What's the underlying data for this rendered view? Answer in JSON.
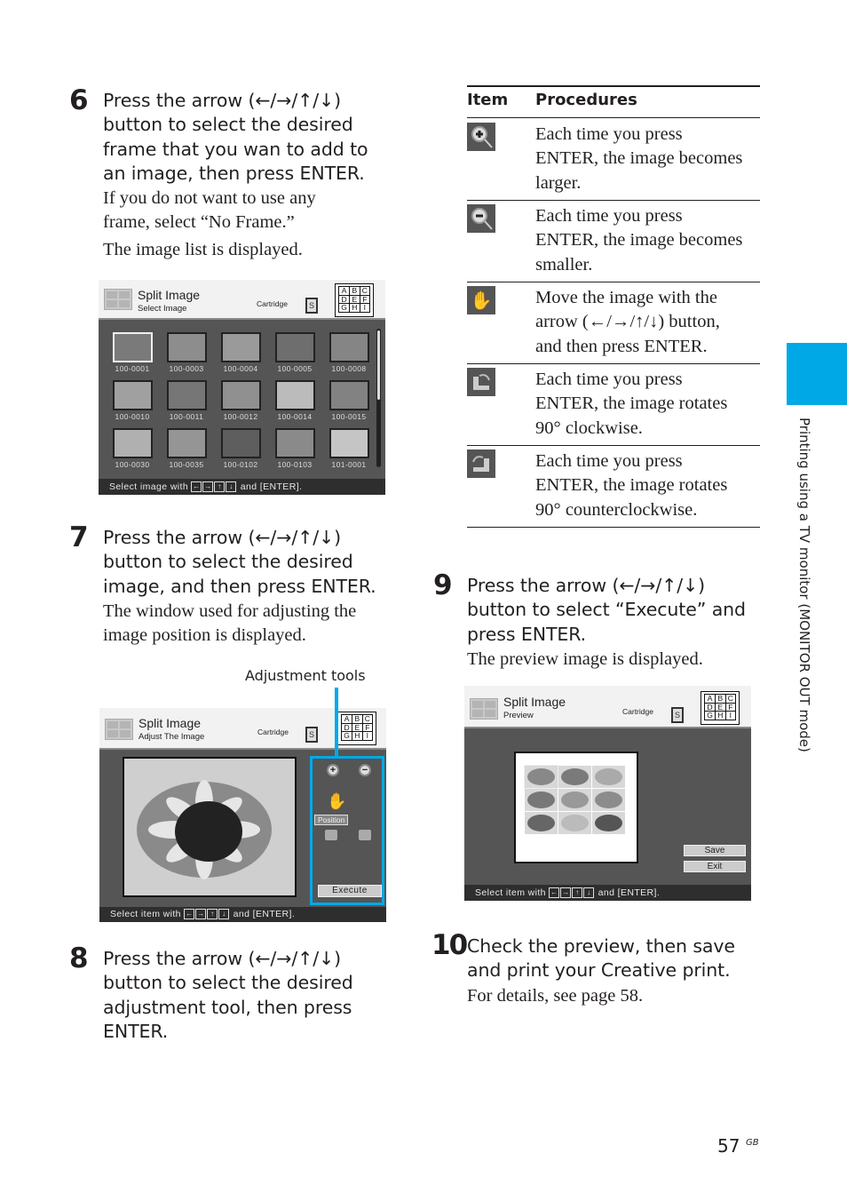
{
  "page": {
    "number": "57",
    "region_suffix": "GB",
    "side_tab_text": "Printing using a TV monitor  (MONITOR OUT mode)",
    "accent_color": "#00a9e6"
  },
  "arrows": "(←/→/↑/↓)",
  "steps": {
    "s6": {
      "number": "6",
      "heading_lines": [
        "Press the arrow  (←/→/↑/↓)",
        "button to select the desired",
        "frame that you wan to add to",
        "an image, then press ENTER."
      ],
      "body_lines": [
        "If you do not want to use any",
        "frame, select “No Frame.”"
      ],
      "result": "The image list is displayed."
    },
    "s7": {
      "number": "7",
      "heading_lines": [
        "Press the arrow (←/→/↑/↓)",
        "button to select the desired",
        "image, and then press ENTER."
      ],
      "body_lines": [
        "The window used for adjusting the",
        "image position is displayed."
      ],
      "callout": "Adjustment tools"
    },
    "s8": {
      "number": "8",
      "heading_lines": [
        "Press the arrow (←/→/↑/↓)",
        "button to select the desired",
        "adjustment tool, then press",
        "ENTER."
      ]
    },
    "s9": {
      "number": "9",
      "heading_lines": [
        "Press the arrow  (←/→/↑/↓)",
        "button to select “Execute” and",
        "press ENTER."
      ],
      "result": "The preview image is displayed."
    },
    "s10": {
      "number": "10",
      "heading_lines": [
        "Check the preview, then save",
        "and print your Creative print."
      ],
      "body": "For details, see page 58."
    }
  },
  "screens": {
    "common": {
      "title": "Split Image",
      "cartridge_label": "Cartridge",
      "cartridge_letter": "S",
      "grid_letters": [
        [
          "A",
          "B",
          "C"
        ],
        [
          "D",
          "E",
          "F"
        ],
        [
          "G",
          "H",
          "I"
        ]
      ],
      "keys": [
        "←",
        "→",
        "↑",
        "↓"
      ],
      "enter": "and [ENTER]."
    },
    "select": {
      "subtitle": "Select Image",
      "footer_prefix": "Select image with",
      "thumbnails": [
        "100-0001",
        "100-0003",
        "100-0004",
        "100-0005",
        "100-0008",
        "100-0010",
        "100-0011",
        "100-0012",
        "100-0014",
        "100-0015",
        "100-0030",
        "100-0035",
        "100-0102",
        "100-0103",
        "101-0001"
      ],
      "selected_index": 0
    },
    "adjust": {
      "subtitle": "Adjust The Image",
      "footer_prefix": "Select item with",
      "tools": [
        "zoom-in",
        "zoom-out",
        "position",
        "rotate-counterclockwise",
        "rotate-clockwise"
      ],
      "position_label": "Position",
      "execute_label": "Execute"
    },
    "preview": {
      "subtitle": "Preview",
      "footer_prefix": "Select item with",
      "save_label": "Save",
      "exit_label": "Exit"
    }
  },
  "table": {
    "headers": [
      "Item",
      "Procedures"
    ],
    "rows": [
      {
        "icon": "zoom-in-icon",
        "lines": [
          "Each time you press",
          "ENTER, the image becomes",
          "larger."
        ]
      },
      {
        "icon": "zoom-out-icon",
        "lines": [
          "Each time you press",
          "ENTER, the image becomes",
          "smaller."
        ]
      },
      {
        "icon": "hand-icon",
        "lines": [
          "Move the image with the",
          "arrow (←/→/↑/↓) button,",
          "and then press ENTER."
        ]
      },
      {
        "icon": "rotate-clockwise-icon",
        "lines": [
          "Each time you press",
          "ENTER, the image rotates",
          "90° clockwise."
        ]
      },
      {
        "icon": "rotate-counterclockwise-icon",
        "lines": [
          "Each time you press",
          "ENTER, the image rotates",
          "90° counterclockwise."
        ]
      }
    ]
  }
}
